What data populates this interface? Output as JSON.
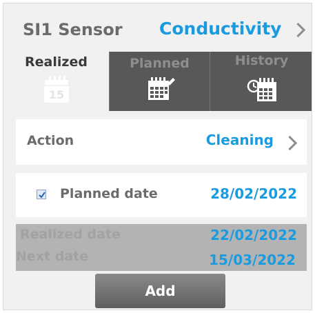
{
  "header": {
    "sensor_label": "SI1 Sensor",
    "sensor_type": "Conductivity"
  },
  "tabs": [
    {
      "label": "Realized",
      "icon": "calendar-15-icon",
      "active": true
    },
    {
      "label": "Planned",
      "icon": "calendar-edit-icon",
      "active": false
    },
    {
      "label": "History",
      "icon": "calendar-history-icon",
      "active": false
    }
  ],
  "realized_icon_day": "15",
  "action": {
    "label": "Action",
    "value": "Cleaning"
  },
  "planned_date": {
    "label": "Planned date",
    "value": "28/02/2022",
    "checked": true
  },
  "realized_date": {
    "label": "Realized date",
    "value": "22/02/2022"
  },
  "next_date": {
    "label": "Next date",
    "value": "15/03/2022"
  },
  "add_button_label": "Add",
  "colors": {
    "accent": "#1a9be0",
    "tab_inactive": "#58585a",
    "panel_bg": "#f1f1f1"
  }
}
